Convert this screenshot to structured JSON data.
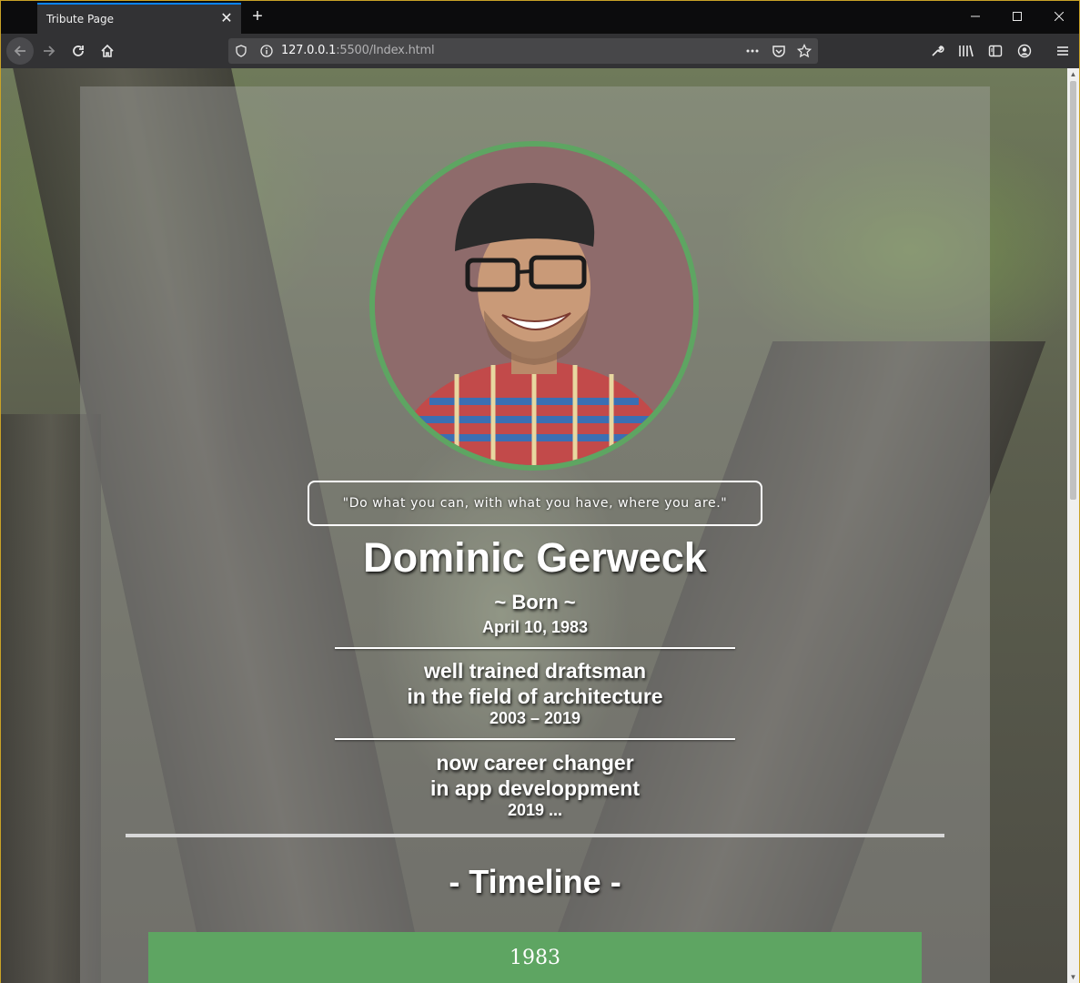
{
  "browser": {
    "tab_title": "Tribute Page",
    "url_host": "127.0.0.1",
    "url_rest": ":5500/Index.html",
    "accent": "#0a84ff"
  },
  "page": {
    "quote": "\"Do what you can, with what you have, where you are.\"",
    "name": "Dominic Gerweck",
    "born_label": "~ Born ~",
    "born_date": "April 10, 1983",
    "job1_line1": "well trained draftsman",
    "job1_line2": "in the field of architecture",
    "job1_years": "2003 – 2019",
    "job2_line1": "now career changer",
    "job2_line2": "in app developpment",
    "job2_years": "2019 ...",
    "timeline_title": "- Timeline -",
    "timeline_first_year": "1983",
    "accent_green": "#5ea562"
  }
}
